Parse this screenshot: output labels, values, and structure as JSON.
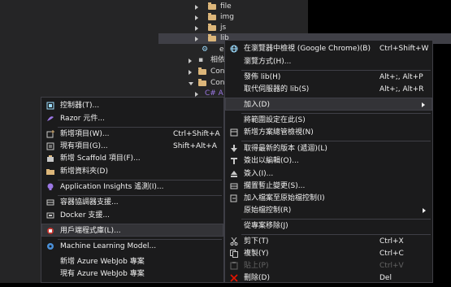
{
  "explorer": {
    "tree": [
      {
        "label": "file"
      },
      {
        "label": "img"
      },
      {
        "label": "js"
      },
      {
        "label": "lib"
      },
      {
        "label": "e"
      },
      {
        "label": "相依"
      },
      {
        "label": "Con"
      },
      {
        "label": "Con"
      },
      {
        "label": "C# A"
      }
    ]
  },
  "context_menu": {
    "items": [
      {
        "label": "在瀏覽器中檢視 (Google Chrome)(B)",
        "shortcut": "Ctrl+Shift+W",
        "icon": "globe-icon"
      },
      {
        "label": "瀏覽方式(H)...",
        "shortcut": ""
      },
      {
        "label": "發佈 lib(H)",
        "shortcut": "Alt+;, Alt+P"
      },
      {
        "label": "取代伺服器的 lib(S)",
        "shortcut": "Alt+;, Alt+R"
      },
      {
        "label": "加入(D)",
        "shortcut": ""
      },
      {
        "label": "將範圍設定在此(S)",
        "shortcut": ""
      },
      {
        "label": "新增方案總管檢視(N)",
        "shortcut": "",
        "icon": "new-view-icon"
      },
      {
        "label": "取得最新的版本 (遞迴)(L)",
        "shortcut": "",
        "icon": "get-latest-icon"
      },
      {
        "label": "簽出以編輯(O)...",
        "shortcut": "",
        "icon": "checkout-icon"
      },
      {
        "label": "簽入(I)...",
        "shortcut": "",
        "icon": "checkin-icon"
      },
      {
        "label": "擱置暫止變更(S)...",
        "shortcut": "",
        "icon": "shelve-icon"
      },
      {
        "label": "加入檔案至原始檔控制(I)",
        "shortcut": "",
        "icon": "add-source-icon"
      },
      {
        "label": "原始檔控制(R)",
        "shortcut": ""
      },
      {
        "label": "從專案移除(J)",
        "shortcut": ""
      },
      {
        "label": "剪下(T)",
        "shortcut": "Ctrl+X",
        "icon": "cut-icon"
      },
      {
        "label": "複製(Y)",
        "shortcut": "Ctrl+C",
        "icon": "copy-icon"
      },
      {
        "label": "貼上(P)",
        "shortcut": "Ctrl+V",
        "icon": "paste-icon"
      },
      {
        "label": "刪除(D)",
        "shortcut": "Del",
        "icon": "delete-icon"
      }
    ]
  },
  "add_submenu": {
    "items": [
      {
        "label": "控制器(T)...",
        "shortcut": "",
        "icon": "controller-icon"
      },
      {
        "label": "Razor 元件...",
        "shortcut": "",
        "icon": "razor-icon"
      },
      {
        "label": "新增項目(W)...",
        "shortcut": "Ctrl+Shift+A",
        "icon": "new-item-icon"
      },
      {
        "label": "現有項目(G)...",
        "shortcut": "Shift+Alt+A",
        "icon": "existing-item-icon"
      },
      {
        "label": "新增 Scaffold 項目(F)...",
        "shortcut": "",
        "icon": "scaffold-icon"
      },
      {
        "label": "新增資料夾(D)",
        "shortcut": "",
        "icon": "new-folder-icon"
      },
      {
        "label": "Application Insights 遙測(I)...",
        "shortcut": "",
        "icon": "insights-icon"
      },
      {
        "label": "容器協調器支援...",
        "shortcut": "",
        "icon": "container-icon"
      },
      {
        "label": "Docker 支援...",
        "shortcut": "",
        "icon": "docker-icon"
      },
      {
        "label": "用戶端程式庫(L)...",
        "shortcut": "",
        "icon": "client-library-icon"
      },
      {
        "label": "Machine Learning Model...",
        "shortcut": "",
        "icon": "ml-icon"
      },
      {
        "label": "新增 Azure WebJob 專案",
        "shortcut": ""
      },
      {
        "label": "現有 Azure WebJob 專案",
        "shortcut": ""
      }
    ]
  }
}
